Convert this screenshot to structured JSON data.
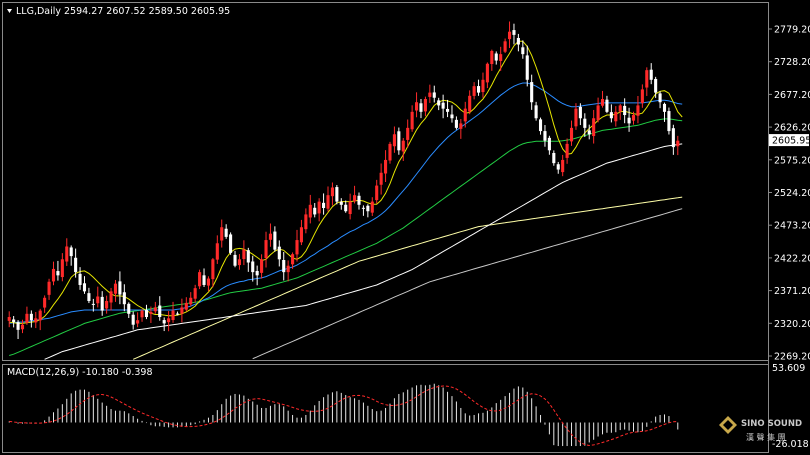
{
  "header": {
    "symbol_label": "LLG,Daily",
    "ohlc": "2594.27 2607.52 2589.50 2605.95"
  },
  "macd_header": "MACD(12,26,9) -10.180 -0.398",
  "price_label": "2605.95",
  "watermark": {
    "line1": "SINO SOUND",
    "line2": "漢 聲 集 團"
  },
  "colors": {
    "up_candle": "#ff2a2a",
    "down_candle": "#ffffff",
    "ma_fast": "#e6e600",
    "ma_mid": "#2a8cff",
    "ma_slow": "#22cc44",
    "ma_100": "#ffffff",
    "ma_150": "#ffffa8",
    "ma_200": "#c8c8c8",
    "macd_bar": "#e8e8e8",
    "macd_signal": "#ff2a2a",
    "price_tag_bg": "#ffffff",
    "price_tag_text": "#000000"
  },
  "chart_data": [
    {
      "type": "candlestick",
      "name": "LLG,Daily",
      "ylim": [
        2269.2,
        2800
      ],
      "yticks": [
        "2779.20",
        "2728.20",
        "2677.20",
        "2626.20",
        "2575.20",
        "2524.20",
        "2473.20",
        "2422.20",
        "2371.20",
        "2320.20",
        "2269.20"
      ],
      "ytick_values": [
        2779.2,
        2728.2,
        2677.2,
        2626.2,
        2575.2,
        2524.2,
        2473.2,
        2422.2,
        2371.2,
        2320.2,
        2269.2
      ],
      "last": {
        "open": 2594.27,
        "high": 2607.52,
        "low": 2589.5,
        "close": 2605.95
      },
      "close_series": [
        2330,
        2322,
        2310,
        2318,
        2335,
        2325,
        2328,
        2340,
        2360,
        2385,
        2405,
        2395,
        2420,
        2440,
        2425,
        2400,
        2380,
        2370,
        2355,
        2350,
        2362,
        2340,
        2355,
        2370,
        2382,
        2365,
        2350,
        2335,
        2318,
        2325,
        2340,
        2330,
        2338,
        2345,
        2330,
        2320,
        2328,
        2340,
        2335,
        2345,
        2352,
        2360,
        2375,
        2400,
        2380,
        2390,
        2420,
        2445,
        2470,
        2455,
        2430,
        2410,
        2420,
        2435,
        2415,
        2400,
        2395,
        2420,
        2450,
        2460,
        2435,
        2420,
        2400,
        2410,
        2428,
        2450,
        2470,
        2490,
        2505,
        2490,
        2510,
        2500,
        2520,
        2532,
        2510,
        2505,
        2495,
        2510,
        2520,
        2505,
        2500,
        2495,
        2510,
        2535,
        2555,
        2575,
        2600,
        2615,
        2590,
        2605,
        2625,
        2650,
        2665,
        2650,
        2670,
        2680,
        2672,
        2660,
        2655,
        2650,
        2640,
        2625,
        2632,
        2655,
        2675,
        2690,
        2680,
        2700,
        2725,
        2745,
        2730,
        2740,
        2760,
        2775,
        2770,
        2755,
        2740,
        2700,
        2665,
        2640,
        2620,
        2605,
        2590,
        2570,
        2560,
        2575,
        2600,
        2625,
        2655,
        2640,
        2625,
        2615,
        2640,
        2660,
        2670,
        2650,
        2640,
        2650,
        2660,
        2645,
        2632,
        2645,
        2660,
        2685,
        2715,
        2700,
        2680,
        2665,
        2650,
        2620,
        2595,
        2605
      ],
      "ma_fast": [
        2322,
        2321,
        2320,
        2320,
        2321,
        2322,
        2323,
        2326,
        2331,
        2339,
        2349,
        2358,
        2368,
        2380,
        2392,
        2398,
        2401,
        2402,
        2398,
        2392,
        2385,
        2378,
        2372,
        2366,
        2363,
        2363,
        2362,
        2358,
        2353,
        2348,
        2344,
        2340,
        2336,
        2334,
        2334,
        2333,
        2332,
        2332,
        2333,
        2335,
        2338,
        2342,
        2347,
        2355,
        2362,
        2369,
        2378,
        2392,
        2408,
        2422,
        2431,
        2436,
        2437,
        2436,
        2432,
        2428,
        2423,
        2418,
        2420,
        2427,
        2433,
        2436,
        2434,
        2428,
        2422,
        2420,
        2424,
        2433,
        2446,
        2460,
        2473,
        2484,
        2493,
        2502,
        2508,
        2510,
        2510,
        2510,
        2511,
        2512,
        2511,
        2508,
        2506,
        2506,
        2512,
        2523,
        2538,
        2556,
        2572,
        2583,
        2596,
        2609,
        2622,
        2632,
        2640,
        2650,
        2660,
        2665,
        2668,
        2667,
        2665,
        2660,
        2653,
        2648,
        2649,
        2655,
        2663,
        2670,
        2680,
        2692,
        2706,
        2718,
        2730,
        2741,
        2753,
        2760,
        2760,
        2752,
        2738,
        2720,
        2700,
        2678,
        2655,
        2630,
        2608,
        2592,
        2584,
        2585,
        2595,
        2608,
        2617,
        2624,
        2630,
        2637,
        2642,
        2645,
        2645,
        2646,
        2650,
        2651,
        2649,
        2647,
        2646,
        2648,
        2657,
        2668,
        2678,
        2682,
        2683,
        2679,
        2665,
        2650,
        2642
      ],
      "ma_mid": [
        2320,
        2321,
        2322,
        2322,
        2323,
        2324,
        2325,
        2326,
        2327,
        2328,
        2330,
        2332,
        2334,
        2336,
        2338,
        2339,
        2340,
        2341,
        2341,
        2341,
        2341,
        2341,
        2341,
        2341,
        2341,
        2341,
        2341,
        2341,
        2341,
        2341,
        2341,
        2341,
        2341,
        2341,
        2341,
        2341,
        2341,
        2341,
        2342,
        2343,
        2345,
        2347,
        2350,
        2353,
        2357,
        2360,
        2364,
        2369,
        2374,
        2378,
        2381,
        2383,
        2385,
        2386,
        2388,
        2389,
        2390,
        2391,
        2393,
        2396,
        2399,
        2402,
        2404,
        2406,
        2408,
        2411,
        2415,
        2419,
        2424,
        2428,
        2433,
        2437,
        2441,
        2446,
        2450,
        2455,
        2459,
        2463,
        2466,
        2470,
        2474,
        2477,
        2481,
        2485,
        2490,
        2496,
        2503,
        2511,
        2519,
        2527,
        2535,
        2544,
        2553,
        2562,
        2571,
        2580,
        2588,
        2596,
        2603,
        2610,
        2616,
        2621,
        2626,
        2631,
        2636,
        2641,
        2646,
        2652,
        2658,
        2664,
        2670,
        2676,
        2681,
        2686,
        2690,
        2693,
        2695,
        2695,
        2693,
        2690,
        2686,
        2682,
        2677,
        2672,
        2667,
        2663,
        2660,
        2658,
        2658,
        2659,
        2660,
        2661,
        2662,
        2663,
        2664,
        2664,
        2664,
        2664,
        2664,
        2664,
        2664,
        2664,
        2664,
        2664,
        2665,
        2666,
        2667,
        2668,
        2668,
        2667,
        2665,
        2663,
        2662
      ],
      "ma_slow": [
        2270,
        2272,
        2275,
        2278,
        2281,
        2284,
        2287,
        2290,
        2293,
        2296,
        2299,
        2302,
        2305,
        2308,
        2311,
        2314,
        2317,
        2320,
        2322,
        2324,
        2326,
        2328,
        2330,
        2332,
        2334,
        2336,
        2337,
        2338,
        2339,
        2340,
        2341,
        2342,
        2343,
        2344,
        2345,
        2346,
        2347,
        2348,
        2349,
        2350,
        2351,
        2352,
        2353,
        2354,
        2356,
        2358,
        2360,
        2362,
        2364,
        2366,
        2368,
        2369,
        2370,
        2371,
        2372,
        2373,
        2374,
        2375,
        2377,
        2379,
        2381,
        2383,
        2385,
        2387,
        2389,
        2391,
        2394,
        2397,
        2400,
        2403,
        2406,
        2409,
        2412,
        2415,
        2418,
        2421,
        2424,
        2427,
        2430,
        2433,
        2436,
        2439,
        2442,
        2445,
        2449,
        2453,
        2457,
        2461,
        2465,
        2469,
        2474,
        2479,
        2484,
        2489,
        2494,
        2499,
        2504,
        2509,
        2514,
        2519,
        2524,
        2529,
        2534,
        2539,
        2544,
        2549,
        2554,
        2559,
        2564,
        2569,
        2574,
        2579,
        2584,
        2589,
        2593,
        2597,
        2600,
        2602,
        2603,
        2604,
        2604,
        2604,
        2604,
        2604,
        2604,
        2605,
        2606,
        2607,
        2609,
        2611,
        2613,
        2615,
        2617,
        2619,
        2621,
        2622,
        2623,
        2624,
        2625,
        2626,
        2627,
        2628,
        2629,
        2631,
        2633,
        2635,
        2637,
        2638,
        2639,
        2639,
        2638,
        2637,
        2636
      ],
      "ma_100": [
        2240,
        2243,
        2246,
        2249,
        2252,
        2255,
        2258,
        2261,
        2264,
        2267,
        2270,
        2273,
        2276,
        2278,
        2280,
        2282,
        2284,
        2286,
        2288,
        2290,
        2292,
        2294,
        2296,
        2298,
        2300,
        2302,
        2304,
        2306,
        2308,
        2310,
        2311,
        2312,
        2313,
        2314,
        2315,
        2316,
        2317,
        2318,
        2319,
        2320,
        2321,
        2322,
        2323,
        2324,
        2325,
        2326,
        2327,
        2328,
        2329,
        2330,
        2331,
        2332,
        2333,
        2334,
        2335,
        2336,
        2337,
        2338,
        2339,
        2340,
        2341,
        2342,
        2343,
        2344,
        2345,
        2346,
        2347,
        2348,
        2350,
        2352,
        2354,
        2356,
        2358,
        2360,
        2362,
        2364,
        2366,
        2368,
        2370,
        2372,
        2374,
        2376,
        2378,
        2380,
        2383,
        2386,
        2389,
        2392,
        2395,
        2398,
        2401,
        2404,
        2408,
        2412,
        2416,
        2420,
        2424,
        2428,
        2432,
        2436,
        2440,
        2444,
        2448,
        2452,
        2456,
        2460,
        2464,
        2468,
        2472,
        2476,
        2480,
        2484,
        2488,
        2492,
        2496,
        2500,
        2504,
        2508,
        2512,
        2516,
        2520,
        2524,
        2528,
        2532,
        2536,
        2540,
        2543,
        2546,
        2549,
        2552,
        2555,
        2558,
        2561,
        2564,
        2567,
        2570,
        2572,
        2574,
        2576,
        2578,
        2580,
        2582,
        2584,
        2586,
        2588,
        2590,
        2592,
        2594,
        2596,
        2597,
        2598,
        2599,
        2600
      ],
      "ma_150": [
        2180,
        2183,
        2186,
        2189,
        2192,
        2195,
        2198,
        2201,
        2204,
        2207,
        2210,
        2213,
        2216,
        2219,
        2222,
        2225,
        2228,
        2231,
        2234,
        2237,
        2240,
        2243,
        2246,
        2249,
        2252,
        2255,
        2258,
        2261,
        2264,
        2267,
        2270,
        2273,
        2276,
        2279,
        2282,
        2285,
        2288,
        2291,
        2294,
        2297,
        2300,
        2303,
        2306,
        2309,
        2312,
        2315,
        2318,
        2321,
        2324,
        2327,
        2330,
        2333,
        2336,
        2339,
        2342,
        2345,
        2348,
        2351,
        2354,
        2357,
        2360,
        2363,
        2366,
        2369,
        2372,
        2375,
        2378,
        2381,
        2384,
        2387,
        2390,
        2393,
        2396,
        2399,
        2402,
        2405,
        2408,
        2411,
        2414,
        2417,
        2419,
        2421,
        2423,
        2425,
        2427,
        2429,
        2431,
        2433,
        2435,
        2437,
        2439,
        2441,
        2443,
        2445,
        2447,
        2449,
        2451,
        2453,
        2455,
        2457,
        2459,
        2461,
        2463,
        2465,
        2467,
        2469,
        2471,
        2472,
        2473,
        2474,
        2475,
        2476,
        2477,
        2478,
        2479,
        2480,
        2481,
        2482,
        2483,
        2484,
        2485,
        2486,
        2487,
        2488,
        2489,
        2490,
        2491,
        2492,
        2493,
        2494,
        2495,
        2496,
        2497,
        2498,
        2499,
        2500,
        2501,
        2502,
        2503,
        2504,
        2505,
        2506,
        2507,
        2508,
        2509,
        2510,
        2511,
        2512,
        2513,
        2514,
        2515,
        2516,
        2517
      ],
      "ma_200": [
        2100,
        2103,
        2106,
        2109,
        2112,
        2115,
        2118,
        2121,
        2124,
        2127,
        2130,
        2133,
        2136,
        2139,
        2142,
        2145,
        2148,
        2151,
        2154,
        2157,
        2160,
        2163,
        2166,
        2169,
        2172,
        2175,
        2178,
        2181,
        2184,
        2187,
        2190,
        2193,
        2196,
        2199,
        2202,
        2205,
        2208,
        2211,
        2214,
        2217,
        2220,
        2223,
        2226,
        2229,
        2232,
        2235,
        2238,
        2241,
        2244,
        2247,
        2250,
        2253,
        2256,
        2259,
        2262,
        2265,
        2268,
        2271,
        2274,
        2277,
        2280,
        2283,
        2286,
        2289,
        2292,
        2295,
        2298,
        2301,
        2304,
        2307,
        2310,
        2313,
        2316,
        2319,
        2322,
        2325,
        2328,
        2331,
        2334,
        2337,
        2340,
        2343,
        2346,
        2349,
        2352,
        2355,
        2358,
        2361,
        2364,
        2367,
        2370,
        2373,
        2376,
        2379,
        2382,
        2385,
        2387,
        2389,
        2391,
        2393,
        2395,
        2397,
        2399,
        2401,
        2403,
        2405,
        2407,
        2409,
        2411,
        2413,
        2415,
        2417,
        2419,
        2421,
        2423,
        2425,
        2427,
        2429,
        2431,
        2433,
        2435,
        2437,
        2439,
        2441,
        2443,
        2445,
        2447,
        2449,
        2451,
        2453,
        2455,
        2457,
        2459,
        2461,
        2463,
        2465,
        2467,
        2469,
        2471,
        2473,
        2475,
        2477,
        2479,
        2481,
        2483,
        2485,
        2487,
        2489,
        2491,
        2493,
        2495,
        2497,
        2499
      ]
    },
    {
      "type": "bar",
      "name": "MACD(12,26,9)",
      "ylim": [
        -26.018,
        53.609
      ],
      "yticks": [
        "53.609",
        "-26.018"
      ],
      "ytick_values": [
        53.609,
        -26.018
      ],
      "macd_value": -10.18,
      "signal_value": -0.398
    }
  ]
}
